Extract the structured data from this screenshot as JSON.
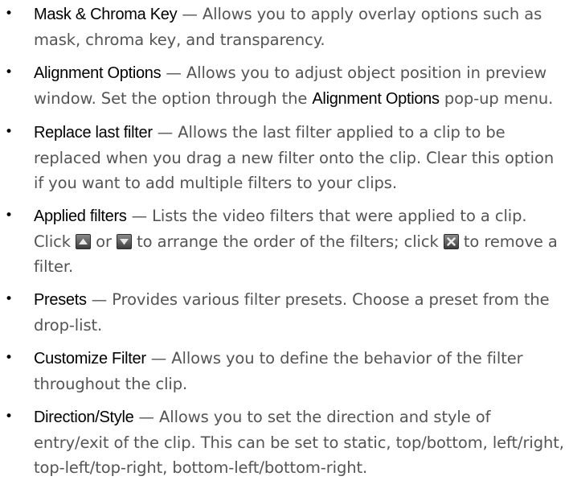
{
  "items": [
    {
      "term": "Mask & Chroma Key",
      "text": " — Allows you to apply overlay options such as mask, chroma key, and transparency."
    },
    {
      "term": "Alignment Options",
      "text": " — Allows you to adjust object position in preview window. Set the option through the ",
      "term2": "Alignment Options",
      "text2": " pop-up menu."
    },
    {
      "term": "Replace last filter",
      "text": " — Allows the last filter applied to a clip to be replaced when you drag a new filter onto the clip. Clear this option if you want to add multiple filters to your clips."
    },
    {
      "term": "Applied filters",
      "text": " — Lists the video filters that were applied to a clip. Click ",
      "or": " or ",
      "text_mid": " to arrange the order of the filters; click ",
      "text_end": " to remove a filter.",
      "icons": [
        "move-up-icon",
        "move-down-icon",
        "remove-icon"
      ]
    },
    {
      "term": "Presets",
      "text": " — Provides various filter presets. Choose a preset from the drop-list."
    },
    {
      "term": "Customize Filter",
      "text": " — Allows you to define the behavior of the filter throughout the clip."
    },
    {
      "term": "Direction/Style",
      "text": " — Allows you to set the direction and style of entry/exit of the clip. This can be set to static, top/bottom, left/right, top-left/top-right, bottom-left/bottom-right."
    }
  ],
  "bullet_glyph": "•",
  "colors": {
    "term": "#000000",
    "body_text": "#545454"
  }
}
